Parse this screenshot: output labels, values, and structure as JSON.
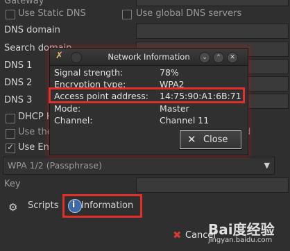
{
  "settings": {
    "gateway_label": "Gateway",
    "use_static_dns_label": "Use Static DNS",
    "use_global_dns_label": "Use global DNS servers",
    "dns_domain_label": "DNS domain",
    "search_domain_label": "Search domain",
    "dns1_label": "DNS 1",
    "dns2_label": "DNS 2",
    "dns3_label": "DNS 3",
    "dhcp_label": "DHCP H",
    "use_these_label": "Use the",
    "use_encryption_label": "Use Enc",
    "partial_d": "d",
    "encryption_select": "WPA 1/2 (Passphrase)",
    "key_label": "Key",
    "scripts_label": "Scripts",
    "information_label": "Information",
    "cancel_label": "Cancel"
  },
  "dialog": {
    "title": "Network Information",
    "rows": [
      {
        "label": "Signal strength:",
        "value": "78%"
      },
      {
        "label": "Encryption type:",
        "value": "WPA2"
      },
      {
        "label": "Access point address:",
        "value": "14:75:90:A1:6B:71"
      },
      {
        "label": "Mode:",
        "value": "Master"
      },
      {
        "label": "Channel:",
        "value": "Channel 11"
      }
    ],
    "close_label": "Close"
  },
  "watermark": {
    "text": "Bai度经验",
    "url": "jingyan.baidu.com"
  },
  "colors": {
    "highlight": "#e0302a",
    "background": "#2f2f2f"
  }
}
